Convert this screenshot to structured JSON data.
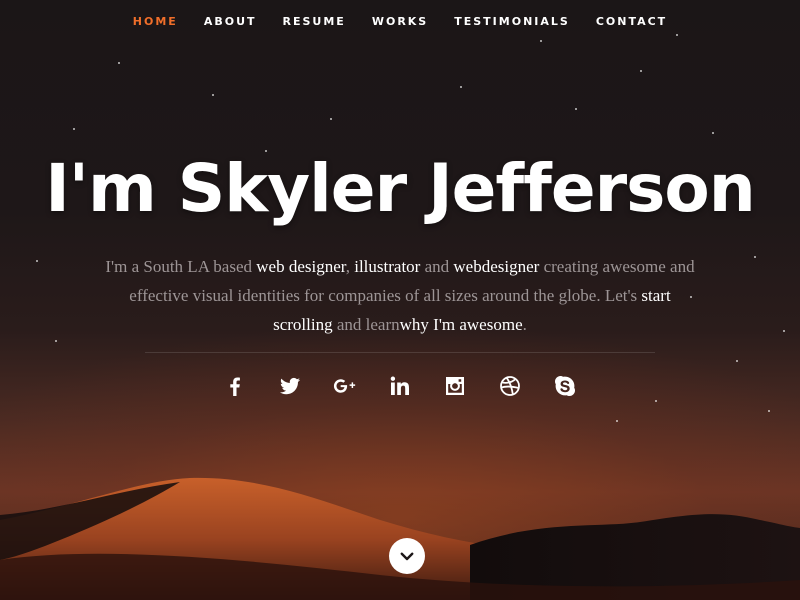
{
  "nav": {
    "items": [
      {
        "label": "HOME",
        "active": true
      },
      {
        "label": "ABOUT",
        "active": false
      },
      {
        "label": "RESUME",
        "active": false
      },
      {
        "label": "WORKS",
        "active": false
      },
      {
        "label": "TESTIMONIALS",
        "active": false
      },
      {
        "label": "CONTACT",
        "active": false
      }
    ]
  },
  "hero": {
    "headline": "I'm Skyler Jefferson",
    "intro": {
      "t1": "I'm a South LA based ",
      "h1": "web designer",
      "t2": ", ",
      "h2": "illustrator",
      "t3": " and ",
      "h3": "webdesigner",
      "t4": " creating awesome and effective visual identities for companies of all sizes around the globe. Let's ",
      "h4": "start scrolling",
      "t5": " and learn",
      "h5": "why I'm awesome",
      "t6": "."
    }
  },
  "social": {
    "icons": [
      "facebook-icon",
      "twitter-icon",
      "google-plus-icon",
      "linkedin-icon",
      "instagram-icon",
      "dribbble-icon",
      "skype-icon"
    ]
  },
  "scroll": {
    "icon": "chevron-down-icon"
  },
  "colors": {
    "accent": "#f06e2a",
    "text": "#ffffff",
    "muted_text": "#9d9596",
    "background": "#1d1718"
  }
}
